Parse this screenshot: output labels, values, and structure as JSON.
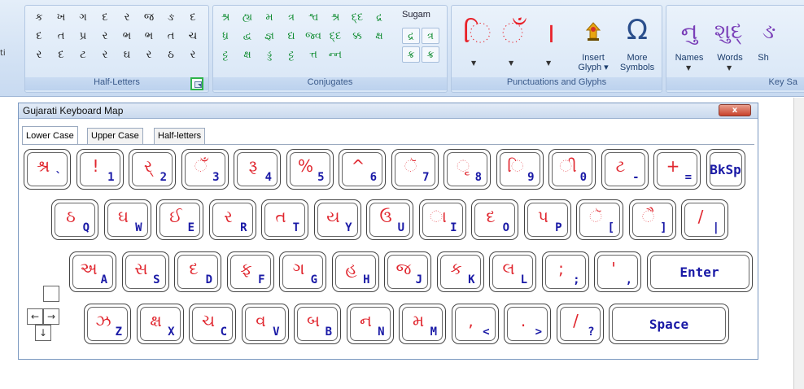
{
  "ribbon": {
    "left_peek": "ti",
    "half_letters": {
      "label": "Half-Letters",
      "rows": [
        [
          "ક",
          "ખ",
          "ગ",
          "દ",
          "ર",
          "જ",
          "ઙ",
          "દ"
        ],
        [
          "દ",
          "ત",
          "પ્ર",
          "ર",
          "ભ",
          "ભ",
          "ત",
          "ચ"
        ],
        [
          "ર",
          "દ",
          "ટ",
          "ર",
          "ઘ",
          "ર",
          "ઠ",
          "ર"
        ]
      ]
    },
    "conjugates": {
      "label": "Conjugates",
      "rows": [
        [
          "શ્ર",
          "હ્ય",
          "મ",
          "ત્ર",
          "શ્વ",
          "શ્ર",
          "દ્દ",
          "દ્ર"
        ],
        [
          "ધ્ર",
          "દ્વ",
          "જ્ઞ",
          "દ્ય",
          "જ્વ",
          "દ્દ",
          "ક્ક",
          "ક્ષ"
        ],
        [
          "ટ્ટ",
          "ક્ષ",
          "ડ્ડ",
          "ટ્ટ",
          "ત્ત",
          "ન્ન"
        ]
      ],
      "sugam_label": "Sugam",
      "sugam_rows": [
        [
          "દ્ર",
          "ત્ર"
        ],
        [
          "ક્ર",
          "ક્ર"
        ]
      ]
    },
    "punctuations": {
      "label": "Punctuations and Glyphs",
      "glyphs": [
        "િ",
        "ઁ",
        "।"
      ],
      "insert_glyph_label": "Insert",
      "insert_glyph_label2": "Glyph",
      "more_symbols_label": "More",
      "more_symbols_label2": "Symbols",
      "omega": "Ω"
    },
    "key_save": {
      "label": "Key Sa",
      "names_label": "Names",
      "words_label": "Words",
      "third_label": "Sh",
      "glyphs": [
        "નુ",
        "શુદ્",
        "ઙ"
      ]
    }
  },
  "dialog": {
    "title": "Gujarati Keyboard Map",
    "close_label": "x",
    "tabs": [
      "Lower Case",
      "Upper Case",
      "Half-letters"
    ],
    "rows": [
      [
        {
          "g": "શ્ર",
          "l": "`"
        },
        {
          "g": "!",
          "l": "1"
        },
        {
          "g": "ર્",
          "l": "2"
        },
        {
          "g": "ઁ",
          "l": "3"
        },
        {
          "g": "રૂ",
          "l": "4"
        },
        {
          "g": "%",
          "l": "5"
        },
        {
          "g": "^",
          "l": "6"
        },
        {
          "g": "ૅ",
          "l": "7"
        },
        {
          "g": "ૃ",
          "l": "8"
        },
        {
          "g": "િ",
          "l": "9"
        },
        {
          "g": "ી",
          "l": "0"
        },
        {
          "g": "ટ",
          "l": "-"
        },
        {
          "g": "+",
          "l": "="
        },
        {
          "g": "",
          "l": "BkSp"
        }
      ],
      [
        {
          "g": "ઠ",
          "l": "Q"
        },
        {
          "g": "ઘ",
          "l": "W"
        },
        {
          "g": "ઈ",
          "l": "E"
        },
        {
          "g": "ર",
          "l": "R"
        },
        {
          "g": "ત",
          "l": "T"
        },
        {
          "g": "ય",
          "l": "Y"
        },
        {
          "g": "ઉ",
          "l": "U"
        },
        {
          "g": "ા",
          "l": "I"
        },
        {
          "g": "દ",
          "l": "O"
        },
        {
          "g": "પ",
          "l": "P"
        },
        {
          "g": "ૅ",
          "l": "["
        },
        {
          "g": "ૈ",
          "l": "]"
        },
        {
          "g": "/",
          "l": "|"
        }
      ],
      [
        {
          "g": "અ",
          "l": "A"
        },
        {
          "g": "સ",
          "l": "S"
        },
        {
          "g": "દ",
          "l": "D"
        },
        {
          "g": "ફ",
          "l": "F"
        },
        {
          "g": "ગ",
          "l": "G"
        },
        {
          "g": "હ",
          "l": "H"
        },
        {
          "g": "જ",
          "l": "J"
        },
        {
          "g": "ક",
          "l": "K"
        },
        {
          "g": "લ",
          "l": "L"
        },
        {
          "g": ";",
          "l": ";"
        },
        {
          "g": "'",
          "l": ","
        },
        {
          "g": "",
          "l": "Enter"
        }
      ],
      [
        {
          "g": "ઝ",
          "l": "Z"
        },
        {
          "g": "ક્ષ",
          "l": "X"
        },
        {
          "g": "ચ",
          "l": "C"
        },
        {
          "g": "વ",
          "l": "V"
        },
        {
          "g": "બ",
          "l": "B"
        },
        {
          "g": "ન",
          "l": "N"
        },
        {
          "g": "મ",
          "l": "M"
        },
        {
          "g": ",",
          "l": "<"
        },
        {
          "g": ".",
          "l": ">"
        },
        {
          "g": "/",
          "l": "?"
        },
        {
          "g": "",
          "l": "Space"
        }
      ]
    ],
    "arrows": {
      "left": "←",
      "right": "→",
      "down": "↓"
    }
  }
}
